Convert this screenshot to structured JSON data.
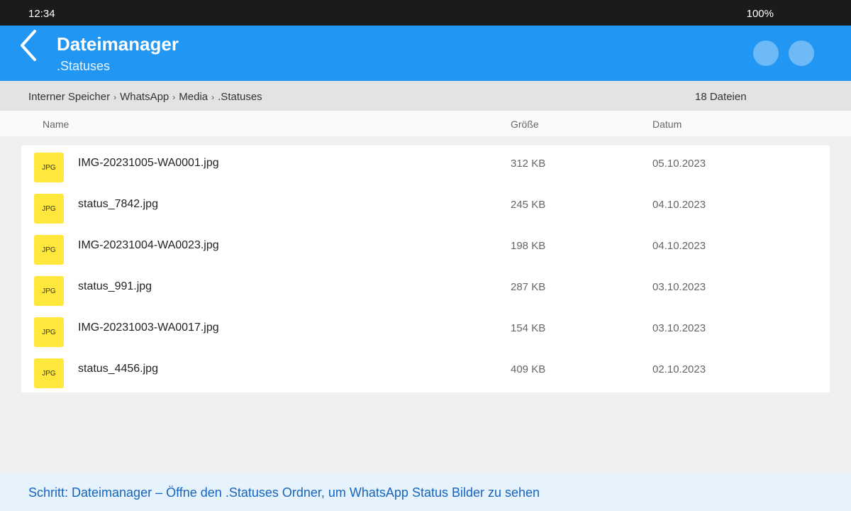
{
  "status_bar": {
    "time": "12:34",
    "battery": "100%"
  },
  "app_bar": {
    "back_icon": "chevron-left-icon",
    "title": "Dateimanager",
    "subtitle": ".Statuses"
  },
  "breadcrumb": {
    "items": [
      "Interner Speicher",
      "WhatsApp",
      "Media",
      ".Statuses"
    ],
    "separator": "›",
    "file_count": "18 Dateien"
  },
  "columns": {
    "name": "Name",
    "size": "Größe",
    "date": "Datum"
  },
  "files": [
    {
      "icon": "JPG",
      "name": "IMG-20231005-WA0001.jpg",
      "size": "312 KB",
      "date": "05.10.2023"
    },
    {
      "icon": "JPG",
      "name": "status_7842.jpg",
      "size": "245 KB",
      "date": "04.10.2023"
    },
    {
      "icon": "JPG",
      "name": "IMG-20231004-WA0023.jpg",
      "size": "198 KB",
      "date": "04.10.2023"
    },
    {
      "icon": "JPG",
      "name": "status_991.jpg",
      "size": "287 KB",
      "date": "03.10.2023"
    },
    {
      "icon": "JPG",
      "name": "IMG-20231003-WA0017.jpg",
      "size": "154 KB",
      "date": "03.10.2023"
    },
    {
      "icon": "JPG",
      "name": "status_4456.jpg",
      "size": "409 KB",
      "date": "02.10.2023"
    }
  ],
  "footer": {
    "hint": "Schritt: Dateimanager – Öffne den .Statuses Ordner, um WhatsApp Status Bilder zu sehen"
  },
  "colors": {
    "app_bar": "#2196f3",
    "status_bar": "#1b1b1b",
    "file_icon": "#ffe83b",
    "footer_text": "#1565c0"
  }
}
